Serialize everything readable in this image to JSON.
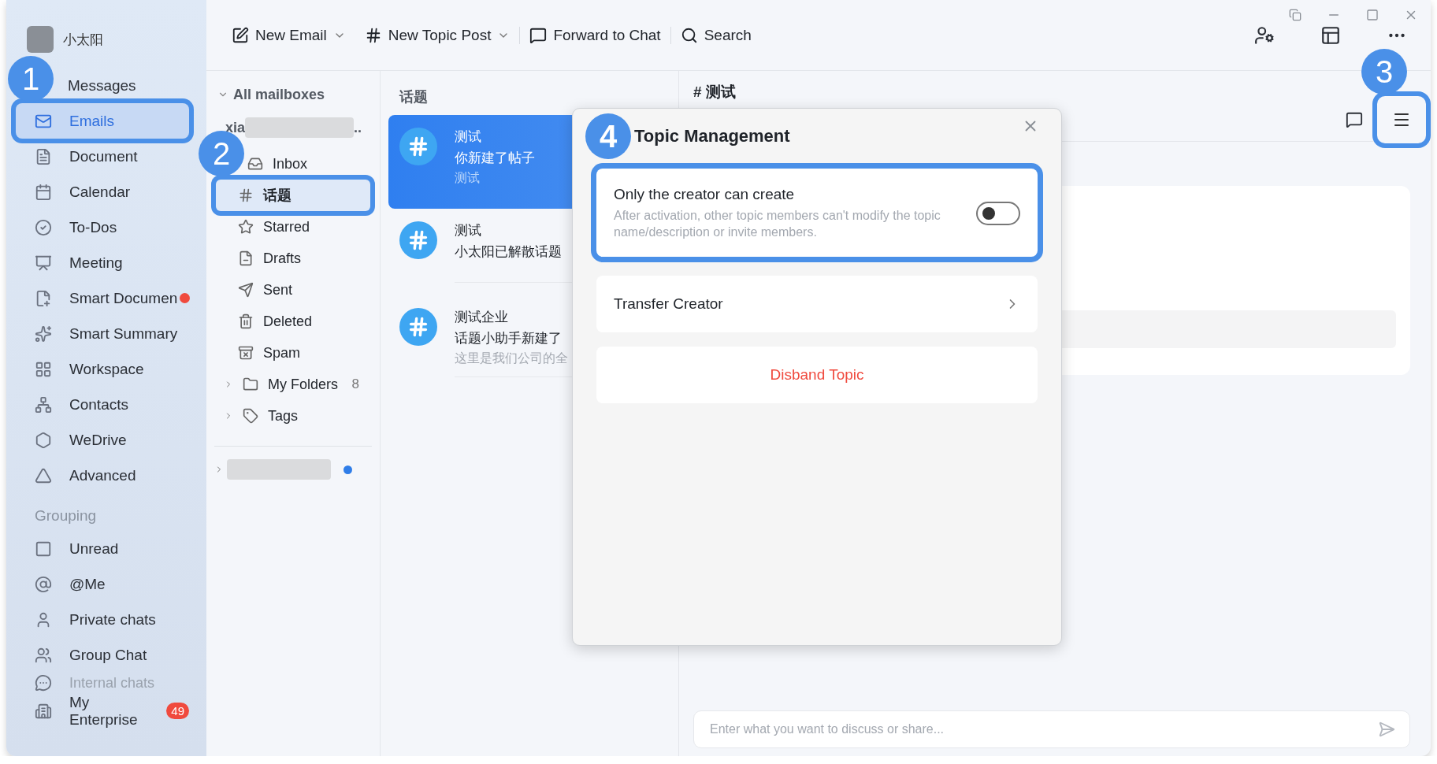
{
  "user": {
    "name": "小太阳"
  },
  "sidebar": {
    "items": [
      {
        "label": "Messages",
        "selected": false
      },
      {
        "label": "Emails",
        "selected": true,
        "callout": "1"
      },
      {
        "label": "Document",
        "selected": false
      },
      {
        "label": "Calendar",
        "selected": false
      },
      {
        "label": "To-Dos",
        "selected": false
      },
      {
        "label": "Meeting",
        "selected": false
      },
      {
        "label": "Smart Documen",
        "selected": false,
        "unread_dot": true
      },
      {
        "label": "Smart Summary",
        "selected": false
      },
      {
        "label": "Workspace",
        "selected": false
      },
      {
        "label": "Contacts",
        "selected": false
      },
      {
        "label": "WeDrive",
        "selected": false
      },
      {
        "label": "Advanced",
        "selected": false
      }
    ],
    "group_heading": "Grouping",
    "groups": [
      {
        "label": "Unread"
      },
      {
        "label": "@Me"
      },
      {
        "label": "Private chats"
      },
      {
        "label": "Group Chat"
      },
      {
        "label": "Internal chats"
      }
    ],
    "enterprise": {
      "label": "My Enterprise",
      "badge": "49"
    }
  },
  "toolbar": {
    "actions": [
      {
        "label": "New Email",
        "dropdown": true
      },
      {
        "label": "New Topic Post",
        "dropdown": true
      },
      {
        "label": "Forward to Chat",
        "dropdown": false
      },
      {
        "label": "Search",
        "dropdown": false
      }
    ]
  },
  "mailboxes": {
    "heading": "All mailboxes",
    "expanded": true,
    "account": {
      "visible_text": "xia",
      "ellipsis": ".."
    },
    "folders": [
      {
        "label": "Inbox",
        "selected": false
      },
      {
        "label": "话题",
        "selected": true,
        "callout": "2"
      },
      {
        "label": "Starred",
        "selected": false
      },
      {
        "label": "Drafts",
        "selected": false
      },
      {
        "label": "Sent",
        "selected": false
      },
      {
        "label": "Deleted",
        "selected": false
      },
      {
        "label": "Spam",
        "selected": false
      },
      {
        "label": "My Folders",
        "selected": false,
        "count": "8",
        "expanded": false
      },
      {
        "label": "Tags",
        "selected": false,
        "expanded": false
      }
    ],
    "other_account": {
      "expanded": false,
      "unread": true
    }
  },
  "topic_list": {
    "heading": "话题",
    "items": [
      {
        "title": "测试",
        "subtitle": "你新建了帖子",
        "preview": "测试",
        "selected": true
      },
      {
        "title": "测试",
        "subtitle": "小太阳已解散话题",
        "selected": false
      },
      {
        "title": "测试企业",
        "subtitle": "话题小助手新建了",
        "preview": "这里是我们公司的全",
        "selected": false
      }
    ]
  },
  "chat": {
    "title": "# 测试",
    "menu_callout": "3",
    "input_placeholder": "Enter what you want to discuss or share..."
  },
  "dialog": {
    "title": "Topic Management",
    "callout": "4",
    "setting": {
      "title": "Only the creator can create",
      "description": "After activation, other topic members can't modify the topic name/description or invite members.",
      "on": false
    },
    "transfer": "Transfer Creator",
    "disband": "Disband Topic"
  }
}
